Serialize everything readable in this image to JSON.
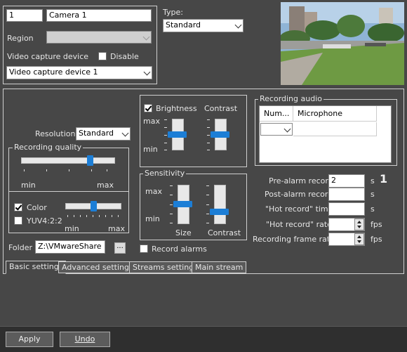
{
  "camera": {
    "id": "1",
    "name": "Camera 1",
    "region_label": "Region",
    "region_value": "",
    "capture_label": "Video capture device",
    "disable_label": "Disable",
    "disable_checked": false,
    "capture_value": "Video capture device 1",
    "type_label": "Type:",
    "type_value": "Standard",
    "preview_icon": "camera-preview-image"
  },
  "image": {
    "resolution_label": "Resolution",
    "resolution_value": "Standard",
    "quality_group": "Recording quality",
    "quality_min": "min",
    "quality_max": "max",
    "quality_level": 0.79,
    "color_label": "Color",
    "color_checked": true,
    "yuv_label": "YUV4:2:2",
    "yuv_checked": false,
    "color_min": "min",
    "color_max": "max",
    "color_level": 0.5,
    "folder_label": "Folder",
    "folder_value": "Z:\\VMwareShare",
    "folder_button": "..."
  },
  "adjust": {
    "brightness_label": "Brightness",
    "brightness_checked": true,
    "contrast_label": "Contrast",
    "max_label": "max",
    "min_label": "min",
    "brightness_level": 0.5,
    "contrast_level": 0.5
  },
  "sensitivity": {
    "group": "Sensitivity",
    "max_label": "max",
    "min_label": "min",
    "size_label": "Size",
    "contrast_label": "Contrast",
    "size_level": 0.55,
    "contrast_level": 0.3,
    "record_alarms_label": "Record alarms",
    "record_alarms_checked": false
  },
  "audio": {
    "group": "Recording audio",
    "columns": [
      "Num...",
      "Microphone"
    ],
    "row_select": "",
    "row_microphone": ""
  },
  "recording": {
    "prealarm_label": "Pre-alarm record",
    "prealarm_value": "2",
    "prealarm_unit": "s",
    "marker": "1",
    "postalarm_label": "Post-alarm record",
    "postalarm_value": "",
    "postalarm_unit": "s",
    "hot_time_label": "\"Hot record\" time",
    "hot_time_value": "",
    "hot_time_unit": "s",
    "hot_rate_label": "\"Hot record\" rate",
    "hot_rate_value": "",
    "hot_rate_unit": "fps",
    "frame_rate_label": "Recording frame rate",
    "frame_rate_value": "",
    "frame_rate_unit": "fps"
  },
  "tabs": [
    {
      "label": "Basic settings",
      "active": true
    },
    {
      "label": "Advanced settings",
      "active": false
    },
    {
      "label": "Streams settings",
      "active": false
    },
    {
      "label": "Main stream",
      "active": false
    }
  ],
  "footer": {
    "apply_label": "Apply",
    "undo_label": "Undo"
  },
  "colors": {
    "background": "#474747",
    "accent": "#1c7ed6",
    "footer": "#2f2f2f"
  }
}
